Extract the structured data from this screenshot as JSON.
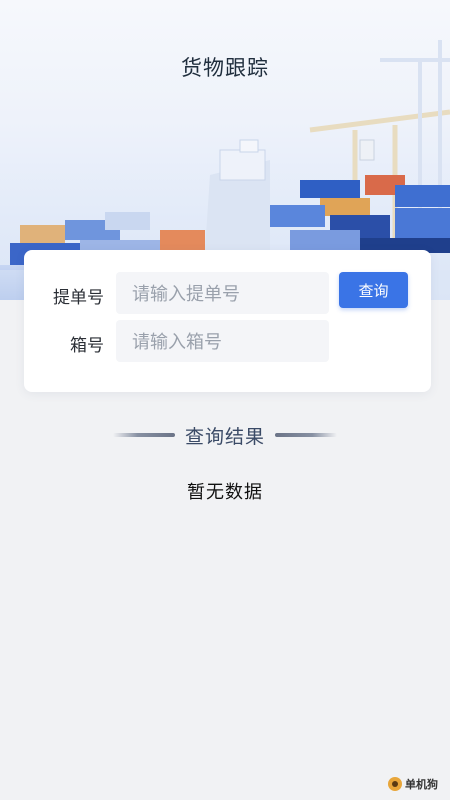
{
  "header": {
    "title": "货物跟踪"
  },
  "search_form": {
    "bill_label": "提单号",
    "bill_placeholder": "请输入提单号",
    "container_label": "箱号",
    "container_placeholder": "请输入箱号",
    "query_label": "查询"
  },
  "results": {
    "title": "查询结果",
    "empty_text": "暂无数据"
  },
  "watermark": {
    "text": "单机狗"
  },
  "colors": {
    "accent": "#3a74e6",
    "background": "#f1f2f4",
    "card": "#ffffff",
    "input_bg": "#f4f5f8"
  },
  "icons": [
    "port-illustration",
    "watermark-logo-icon"
  ]
}
